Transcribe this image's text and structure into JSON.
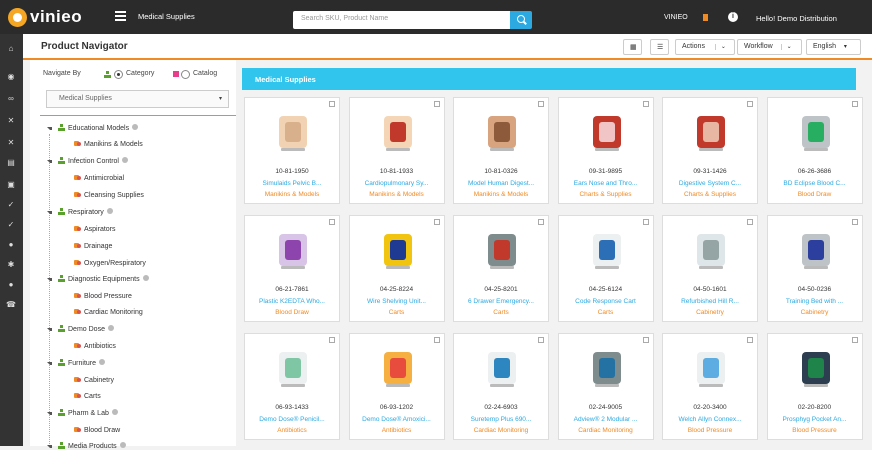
{
  "header": {
    "logo_text": "vinieo",
    "breadcrumb": "Medical Supplies",
    "search_placeholder": "Search SKU, Product Name",
    "brand_label": "VINIEO",
    "greeting": "Hello!  Demo Distribution"
  },
  "panel": {
    "title": "Product Navigator",
    "actions_label": "Actions",
    "workflow_label": "Workflow",
    "language_label": "English"
  },
  "sidebar": {
    "navigate_by_label": "Navigate By",
    "category_label": "Category",
    "catalog_label": "Catalog",
    "selected_view": "Category",
    "dropdown_value": "Medical Supplies",
    "tree": [
      {
        "label": "Educational Models",
        "level": 1
      },
      {
        "label": "Manikins & Models",
        "level": 2
      },
      {
        "label": "Infection Control",
        "level": 1
      },
      {
        "label": "Antimicrobial",
        "level": 2
      },
      {
        "label": "Cleansing Supplies",
        "level": 2
      },
      {
        "label": "Respiratory",
        "level": 1
      },
      {
        "label": "Aspirators",
        "level": 2
      },
      {
        "label": "Drainage",
        "level": 2
      },
      {
        "label": "Oxygen/Respiratory",
        "level": 2
      },
      {
        "label": "Diagnostic Equipments",
        "level": 1
      },
      {
        "label": "Blood Pressure",
        "level": 2
      },
      {
        "label": "Cardiac Monitoring",
        "level": 2
      },
      {
        "label": "Demo Dose",
        "level": 1
      },
      {
        "label": "Antibiotics",
        "level": 2
      },
      {
        "label": "Furniture",
        "level": 1
      },
      {
        "label": "Cabinetry",
        "level": 2
      },
      {
        "label": "Carts",
        "level": 2
      },
      {
        "label": "Pharm & Lab",
        "level": 1
      },
      {
        "label": "Blood Draw",
        "level": 2
      },
      {
        "label": "Media Products",
        "level": 1
      }
    ]
  },
  "content": {
    "title": "Medical Supplies",
    "products": [
      {
        "sku": "10-81-1950",
        "name": "Simulaids Pelvic B...",
        "category": "Manikins & Models",
        "image": "pelvic-model-image"
      },
      {
        "sku": "10-81-1933",
        "name": "Cardiopulmonary Sy...",
        "category": "Manikins & Models",
        "image": "cardio-model-image"
      },
      {
        "sku": "10-81-0326",
        "name": "Model Human Digest...",
        "category": "Manikins & Models",
        "image": "digestive-model-image"
      },
      {
        "sku": "09-31-9895",
        "name": "Ears Nose and Thro...",
        "category": "Charts & Supplies",
        "image": "ent-chart-image"
      },
      {
        "sku": "09-31-1426",
        "name": "Digestive System C...",
        "category": "Charts & Supplies",
        "image": "digestive-chart-image"
      },
      {
        "sku": "06-26-3686",
        "name": "BD Eclipse Blood C...",
        "category": "Blood Draw",
        "image": "needle-image"
      },
      {
        "sku": "06-21-7861",
        "name": "Plastic K2EDTA Who...",
        "category": "Blood Draw",
        "image": "tubes-image"
      },
      {
        "sku": "04-25-8224",
        "name": "Wire Shelving Unit...",
        "category": "Carts",
        "image": "shelving-image"
      },
      {
        "sku": "04-25-8201",
        "name": "6 Drawer Emergency...",
        "category": "Carts",
        "image": "emergency-cart-image"
      },
      {
        "sku": "04-25-6124",
        "name": "Code Response Cart",
        "category": "Carts",
        "image": "code-cart-image"
      },
      {
        "sku": "04-50-1601",
        "name": "Refurbished Hill R...",
        "category": "Cabinetry",
        "image": "hospital-bed-image"
      },
      {
        "sku": "04-50-0236",
        "name": "Training Bed with ...",
        "category": "Cabinetry",
        "image": "training-bed-image"
      },
      {
        "sku": "06-93-1433",
        "name": "Demo Dose® Penicil...",
        "category": "Antibiotics",
        "image": "penicillin-image"
      },
      {
        "sku": "06-93-1202",
        "name": "Demo Dose® Amoxici...",
        "category": "Antibiotics",
        "image": "amoxicillin-image"
      },
      {
        "sku": "02-24-6903",
        "name": "Suretemp Plus 690...",
        "category": "Cardiac Monitoring",
        "image": "thermometer-image"
      },
      {
        "sku": "02-24-9005",
        "name": "Adview® 2 Modular ...",
        "category": "Cardiac Monitoring",
        "image": "monitor-image"
      },
      {
        "sku": "02-20-3400",
        "name": "Welch Allyn Connex...",
        "category": "Blood Pressure",
        "image": "bp-monitor-image"
      },
      {
        "sku": "02-20-8200",
        "name": "Prosphyg Pocket An...",
        "category": "Blood Pressure",
        "image": "sphygmomanometer-image"
      }
    ]
  },
  "rail_icons": [
    "home-icon",
    "dashboard-icon",
    "link-icon",
    "tools-icon",
    "tools-icon",
    "grid-icon",
    "camera-icon",
    "thumbs-up-icon",
    "thumbs-up-icon",
    "user-icon",
    "settings-icon",
    "info-icon",
    "phone-icon"
  ],
  "colors": {
    "accent": "#f08a24",
    "header_bg": "#2b2b2b",
    "content_title_bg": "#31c4ec",
    "link": "#2ca9e1"
  }
}
